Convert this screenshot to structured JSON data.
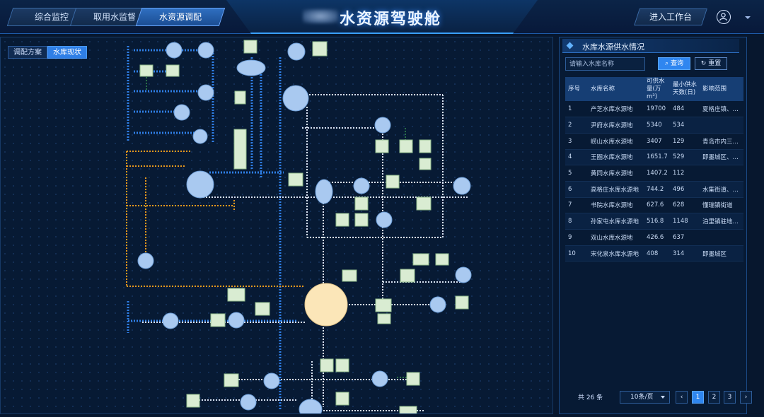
{
  "nav": {
    "tabs": [
      {
        "label": "综合监控"
      },
      {
        "label": "取用水监督"
      },
      {
        "label": "水资源调配"
      }
    ],
    "app_title": "水资源驾驶舱",
    "workbench_label": "进入工作台"
  },
  "map": {
    "tabs": [
      {
        "label": "调配方案"
      },
      {
        "label": "水库现状"
      }
    ]
  },
  "panel": {
    "title": "水库水源供水情况",
    "search_placeholder": "请输入水库名称",
    "query_label": "查询",
    "reset_label": "重置",
    "columns": [
      "序号",
      "水库名称",
      "可供水量(万m³)",
      "最小供水天数(日)",
      "影响范围"
    ],
    "rows": [
      [
        "1",
        "产芝水库水源地",
        "19700",
        "484",
        "夏格庄镇、…"
      ],
      [
        "2",
        "尹府水库水源地",
        "5340",
        "534",
        ""
      ],
      [
        "3",
        "崂山水库水源地",
        "3407",
        "129",
        "青岛市内三…"
      ],
      [
        "4",
        "王圈水库水源地",
        "1651.7",
        "529",
        "即墨城区、…"
      ],
      [
        "5",
        "黄同水库水源地",
        "1407.2",
        "112",
        ""
      ],
      [
        "6",
        "高格庄水库水源地",
        "744.2",
        "496",
        "水集街道、…"
      ],
      [
        "7",
        "书院水库水源地",
        "627.6",
        "628",
        "懂瑞镇街道"
      ],
      [
        "8",
        "孙家屯水库水源地",
        "516.8",
        "1148",
        "泊里镇驻地…"
      ],
      [
        "9",
        "双山水库水源地",
        "426.6",
        "637",
        ""
      ],
      [
        "10",
        "宋化泉水库水源地",
        "408",
        "314",
        "即墨城区"
      ]
    ],
    "pagination": {
      "total_label": "共 26 条",
      "page_size_label": "10条/页",
      "prev": "‹",
      "pages": [
        "1",
        "2",
        "3"
      ],
      "next": "›",
      "current_page": "1"
    }
  },
  "colors": {
    "accent": "#2f86f0",
    "pipe_blue": "#2f7fe6",
    "pipe_orange": "#e59a1c",
    "pipe_white": "#d6e2f2",
    "node_fill": "#a9c9f0",
    "main_reservoir_fill": "#fbe6b8"
  }
}
